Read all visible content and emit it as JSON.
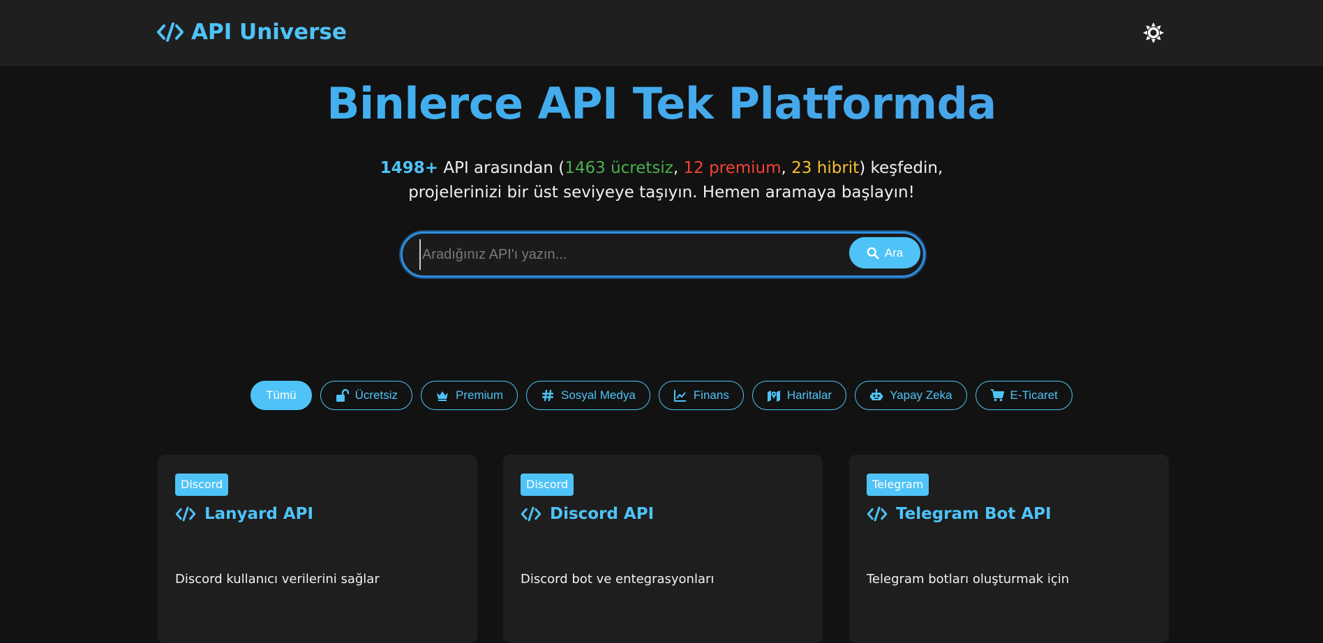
{
  "header": {
    "logo_text": "API Universe",
    "logo_icon": "code-icon",
    "theme_icon": "sun-icon"
  },
  "hero": {
    "title": "Binlerce API Tek Platformda",
    "total": "1498+",
    "text_1": " API arasından (",
    "free": "1463 ücretsiz",
    "sep_1": ", ",
    "premium": "12 premium",
    "sep_2": ", ",
    "hybrid": "23 hibrit",
    "text_2": ") keşfedin,",
    "line_2": "projelerinizi bir üst seviyeye taşıyın. Hemen aramaya başlayın!"
  },
  "search": {
    "placeholder": "Aradığınız API'ı yazın...",
    "value": "",
    "button_label": "Ara",
    "button_icon": "search-icon"
  },
  "filters": [
    {
      "label": "Tümü",
      "icon": "",
      "active": true
    },
    {
      "label": "Ücretsiz",
      "icon": "unlock-icon",
      "active": false
    },
    {
      "label": "Premium",
      "icon": "crown-icon",
      "active": false
    },
    {
      "label": "Sosyal Medya",
      "icon": "hashtag-icon",
      "active": false
    },
    {
      "label": "Finans",
      "icon": "chart-line-icon",
      "active": false
    },
    {
      "label": "Haritalar",
      "icon": "map-icon",
      "active": false
    },
    {
      "label": "Yapay Zeka",
      "icon": "robot-icon",
      "active": false
    },
    {
      "label": "E-Ticaret",
      "icon": "cart-icon",
      "active": false
    }
  ],
  "cards": [
    {
      "badge": "Discord",
      "title": "Lanyard API",
      "description": "Discord kullanıcı verilerini sağlar"
    },
    {
      "badge": "Discord",
      "title": "Discord API",
      "description": "Discord bot ve entegrasyonları"
    },
    {
      "badge": "Telegram",
      "title": "Telegram Bot API",
      "description": "Telegram botları oluşturmak için"
    }
  ],
  "colors": {
    "accent": "#4fc3f7",
    "free": "#4caf50",
    "premium": "#f44336",
    "hybrid": "#fbc02d",
    "background": "#121212",
    "header": "#1f1f1f",
    "card": "#1e1e1e"
  }
}
